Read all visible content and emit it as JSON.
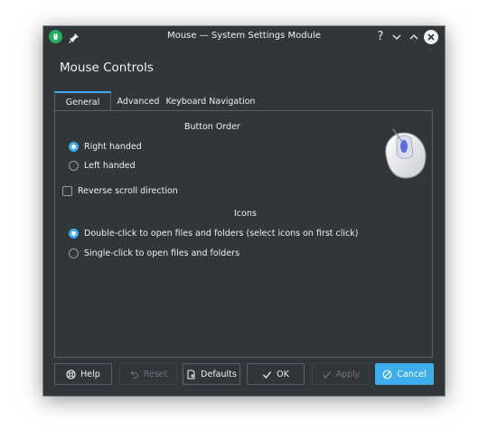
{
  "window": {
    "title": "Mouse — System Settings Module",
    "help_glyph": "?",
    "accent": "#3daee9",
    "background": "#31363b"
  },
  "page_title": "Mouse Controls",
  "tabs": [
    {
      "label": "General",
      "active": true
    },
    {
      "label": "Advanced",
      "active": false
    },
    {
      "label": "Keyboard Navigation",
      "active": false
    }
  ],
  "general": {
    "button_order": {
      "label": "Button Order",
      "options": [
        {
          "label": "Right handed",
          "selected": true
        },
        {
          "label": "Left handed",
          "selected": false
        }
      ]
    },
    "reverse_scroll": {
      "label": "Reverse scroll direction",
      "checked": false
    },
    "icons": {
      "label": "Icons",
      "options": [
        {
          "label": "Double-click to open files and folders (select icons on first click)",
          "selected": true
        },
        {
          "label": "Single-click to open files and folders",
          "selected": false
        }
      ]
    }
  },
  "buttons": {
    "help": {
      "label": "Help",
      "icon": "help-icon"
    },
    "reset": {
      "label": "Reset",
      "icon": "undo-icon",
      "enabled": false
    },
    "defaults": {
      "label": "Defaults",
      "icon": "document-defaults-icon"
    },
    "ok": {
      "label": "OK",
      "icon": "check-icon"
    },
    "apply": {
      "label": "Apply",
      "icon": "check-icon",
      "enabled": false
    },
    "cancel": {
      "label": "Cancel",
      "icon": "cancel-icon"
    }
  }
}
